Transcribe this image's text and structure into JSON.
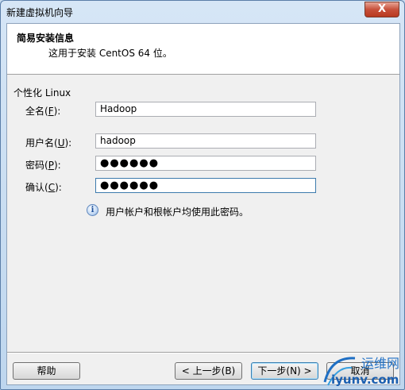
{
  "window": {
    "title": "新建虚拟机向导",
    "close_label": "X"
  },
  "header": {
    "title": "简易安装信息",
    "subtitle": "这用于安装 CentOS 64 位。"
  },
  "section": {
    "label": "个性化 Linux"
  },
  "fields": {
    "fullname": {
      "label_pre": "全名(",
      "hotkey": "F",
      "label_post": "):",
      "value": "Hadoop"
    },
    "username": {
      "label_pre": "用户名(",
      "hotkey": "U",
      "label_post": "):",
      "value": "hadoop"
    },
    "password": {
      "label_pre": "密码(",
      "hotkey": "P",
      "label_post": "):",
      "value": "●●●●●●"
    },
    "confirm": {
      "label_pre": "确认(",
      "hotkey": "C",
      "label_post": "):",
      "value": "●●●●●●"
    }
  },
  "info": {
    "text": "用户帐户和根帐户均使用此密码。",
    "icon": "info-icon"
  },
  "buttons": {
    "help": "帮助",
    "back": "< 上一步(B)",
    "next": "下一步(N) >",
    "cancel": "取消"
  },
  "watermark": {
    "brand": "运维网",
    "domain": "iyunv.com"
  }
}
